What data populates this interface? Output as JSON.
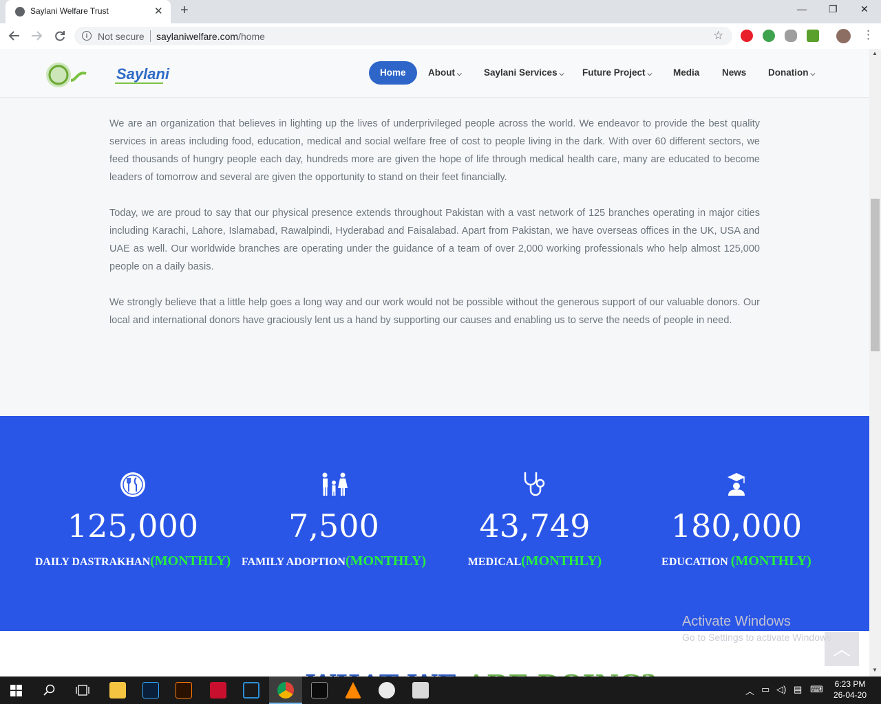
{
  "browser": {
    "tab_title": "Saylani Welfare Trust",
    "tab_close": "✕",
    "new_tab": "+",
    "security_label": "Not secure",
    "url_host": "saylaniwelfare.com",
    "url_path": "/home",
    "window_min": "—",
    "window_restore": "❐",
    "window_close": "✕"
  },
  "site": {
    "logo_text": "Saylani",
    "nav": [
      {
        "label": "Home",
        "active": true
      },
      {
        "label": "About",
        "caret": true
      },
      {
        "label": "Saylani Services",
        "caret": true
      },
      {
        "label": "Future Project",
        "caret": true
      },
      {
        "label": "Media"
      },
      {
        "label": "News"
      },
      {
        "label": "Donation",
        "caret": true
      }
    ],
    "caret_glyph": "⌵",
    "paragraphs": [
      "We are an organization that believes in lighting up the lives of underprivileged people across the world. We endeavor to provide the best quality services in areas including food, education, medical and social welfare free of cost to people living in the dark. With over 60 different sectors, we feed thousands of hungry people each day, hundreds more are given the hope of life through medical health care, many are educated to become leaders of tomorrow and several are given the opportunity to stand on their feet financially.",
      "Today, we are proud to say that our physical presence extends throughout Pakistan with a vast network of 125 branches operating in major cities including Karachi, Lahore, Islamabad, Rawalpindi, Hyderabad and Faisalabad. Apart from Pakistan, we have overseas offices in the UK, USA and UAE as well. Our worldwide branches are operating under the guidance of a team of over 2,000 working professionals who help almost 125,000 people on a daily basis.",
      "We strongly believe that a little help goes a long way and our work would not be possible without the generous support of our valuable donors. Our local and international donors have graciously lent us a hand by supporting our causes and enabling us to serve the needs of people in need."
    ],
    "stats": [
      {
        "number": "125,000",
        "label": "DAILY DASTRAKHAN",
        "period": "(MONTHLY)",
        "icon": "dining-icon"
      },
      {
        "number": "7,500",
        "label": "FAMILY ADOPTION",
        "period": "(MONTHLY)",
        "icon": "family-icon"
      },
      {
        "number": "43,749",
        "label": "MEDICAL",
        "period": "(MONTHLY)",
        "icon": "stethoscope-icon"
      },
      {
        "number": "180,000",
        "label": "EDUCATION ",
        "period": "(MONTHLY)",
        "icon": "graduation-icon"
      }
    ],
    "doing_title_a": "WHAT WE",
    "doing_title_b": " ARE DOING?",
    "to_top": "︿"
  },
  "watermark": {
    "line1": "Activate Windows",
    "line2": "Go to Settings to activate Windows."
  },
  "taskbar": {
    "time": "6:23 PM",
    "date": "26-04-20"
  },
  "colors": {
    "nav_active": "#2d65c8",
    "stats_bg": "#2a56e8",
    "monthly_green": "#27f03c"
  }
}
